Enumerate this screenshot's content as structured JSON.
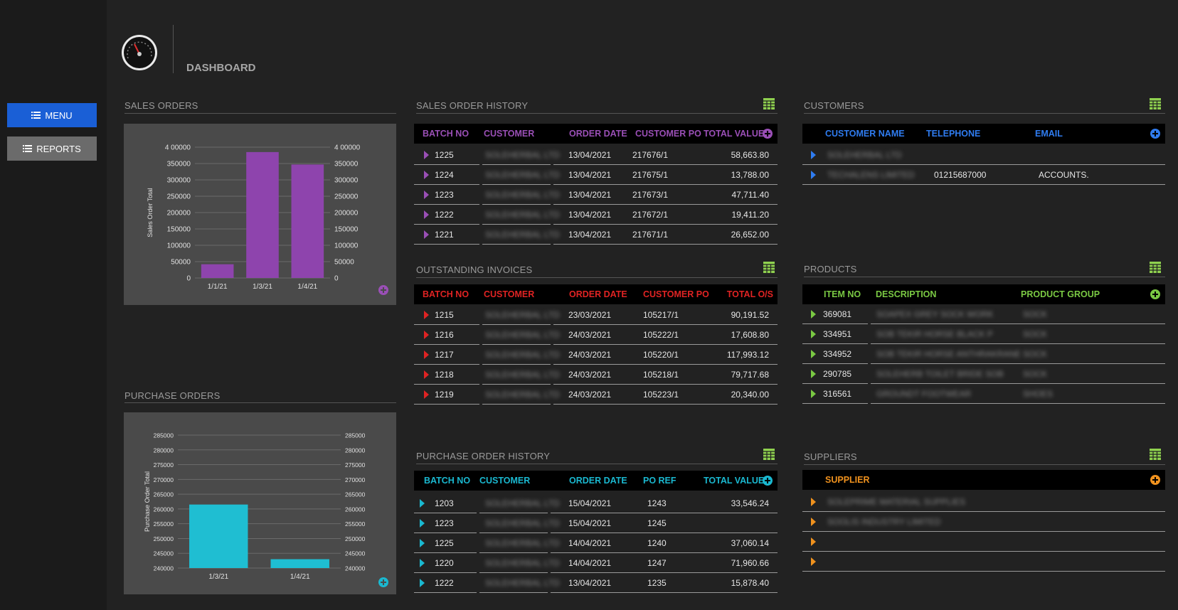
{
  "colors": {
    "sales": "#9a4fb6",
    "invoices": "#e02323",
    "purchase": "#1ab8d0",
    "customers": "#2f7cf0",
    "products": "#7ac943",
    "suppliers": "#f0921e",
    "menu_button": "#1a5fd6",
    "reports_button": "#6b6b6b"
  },
  "sidebar": {
    "menu_label": "MENU",
    "reports_label": "REPORTS",
    "menu_icon": "list-icon",
    "reports_icon": "list-icon"
  },
  "header": {
    "title": "DASHBOARD",
    "icon": "speedometer-icon"
  },
  "sections": {
    "sales_orders": "SALES ORDERS",
    "purchase_orders": "PURCHASE ORDERS",
    "sales_order_history": "SALES ORDER HISTORY",
    "outstanding_invoices": "OUTSTANDING INVOICES",
    "purchase_order_history": "PURCHASE ORDER HISTORY",
    "customers": "CUSTOMERS",
    "products": "PRODUCTS",
    "suppliers": "SUPPLIERS"
  },
  "sales_order_history": {
    "headers": [
      "BATCH NO",
      "CUSTOMER",
      "ORDER DATE",
      "CUSTOMER PO",
      "TOTAL VALUE"
    ],
    "rows": [
      [
        "1225",
        "SOLEHERBAL LTD",
        "13/04/2021",
        "217676/1",
        "58,663.80"
      ],
      [
        "1224",
        "SOLEHERBAL LTD",
        "13/04/2021",
        "217675/1",
        "13,788.00"
      ],
      [
        "1223",
        "SOLEHERBAL LTD",
        "13/04/2021",
        "217673/1",
        "47,711.40"
      ],
      [
        "1222",
        "SOLEHERBAL LTD",
        "13/04/2021",
        "217672/1",
        "19,411.20"
      ],
      [
        "1221",
        "SOLEHERBAL LTD",
        "13/04/2021",
        "217671/1",
        "26,652.00"
      ]
    ]
  },
  "outstanding_invoices": {
    "headers": [
      "BATCH NO",
      "CUSTOMER",
      "ORDER DATE",
      "CUSTOMER PO",
      "TOTAL O/S"
    ],
    "rows": [
      [
        "1215",
        "SOLEHERBAL LTD",
        "23/03/2021",
        "105217/1",
        "90,191.52"
      ],
      [
        "1216",
        "SOLEHERBAL LTD",
        "24/03/2021",
        "105222/1",
        "17,608.80"
      ],
      [
        "1217",
        "SOLEHERBAL LTD",
        "24/03/2021",
        "105220/1",
        "117,993.12"
      ],
      [
        "1218",
        "SOLEHERBAL LTD",
        "24/03/2021",
        "105218/1",
        "79,717.68"
      ],
      [
        "1219",
        "SOLEHERBAL LTD",
        "24/03/2021",
        "105223/1",
        "20,340.00"
      ]
    ]
  },
  "purchase_order_history": {
    "headers": [
      "BATCH NO",
      "CUSTOMER",
      "ORDER DATE",
      "PO REF",
      "TOTAL VALUE"
    ],
    "rows": [
      [
        "1203",
        "SOLEHERBAL LTD",
        "15/04/2021",
        "1243",
        "33,546.24"
      ],
      [
        "1223",
        "SOLEHERBAL LTD",
        "15/04/2021",
        "1245",
        ""
      ],
      [
        "1225",
        "SOLEHERBAL LTD",
        "14/04/2021",
        "1240",
        "37,060.14"
      ],
      [
        "1220",
        "SOLEHERBAL LTD",
        "14/04/2021",
        "1247",
        "71,960.66"
      ],
      [
        "1222",
        "SOLEHERBAL LTD",
        "13/04/2021",
        "1235",
        "15,878.40"
      ]
    ]
  },
  "customers": {
    "headers": [
      "CUSTOMER NAME",
      "TELEPHONE",
      "EMAIL"
    ],
    "rows": [
      [
        "SOLEHERBAL LTD",
        "",
        ""
      ],
      [
        "TECHALENS LIMITED",
        "01215687000",
        "ACCOUNTS."
      ]
    ]
  },
  "products": {
    "headers": [
      "ITEM NO",
      "DESCRIPTION",
      "PRODUCT GROUP"
    ],
    "rows": [
      [
        "369081",
        "SOAPEX GREY SOCK WORK",
        "SOCK"
      ],
      [
        "334951",
        "SOB TEKIR HORSE BLACK P",
        "SOCK"
      ],
      [
        "334952",
        "SOB TEKIR HORSE ANTHRAKRANE",
        "SOCK"
      ],
      [
        "290785",
        "SOLEHERB TOILET BRIDE SOB",
        "SOCK"
      ],
      [
        "316561",
        "GROUNDT FOOTWEAR",
        "SHOES"
      ]
    ]
  },
  "suppliers": {
    "headers": [
      "SUPPLIER"
    ],
    "rows": [
      [
        "SOLEPRIME MATERIAL SUPPLIES"
      ],
      [
        "SOOLIS INDUSTRY LIMITED"
      ],
      [
        ""
      ],
      [
        ""
      ]
    ]
  },
  "chart_data": [
    {
      "type": "bar",
      "ylabel": "Sales Order Total",
      "categories": [
        "1/1/21",
        "1/3/21",
        "1/4/21"
      ],
      "values": [
        42000,
        385000,
        347000
      ],
      "ylim": [
        0,
        400000
      ],
      "yticks": [
        "0",
        "50000",
        "100000",
        "150000",
        "200000",
        "250000",
        "300000",
        "350000",
        "4 00000"
      ],
      "color": "#8e44ad",
      "grid": true,
      "secondary_axis": true
    },
    {
      "type": "bar",
      "ylabel": "Purchase Order Total",
      "categories": [
        "1/3/21",
        "1/4/21"
      ],
      "values": [
        261500,
        243000
      ],
      "ylim": [
        240000,
        285000
      ],
      "yticks": [
        "240000",
        "245000",
        "250000",
        "255000",
        "260000",
        "265000",
        "270000",
        "275000",
        "280000",
        "285000"
      ],
      "color": "#1fbed2",
      "grid": true,
      "secondary_axis": true
    }
  ]
}
